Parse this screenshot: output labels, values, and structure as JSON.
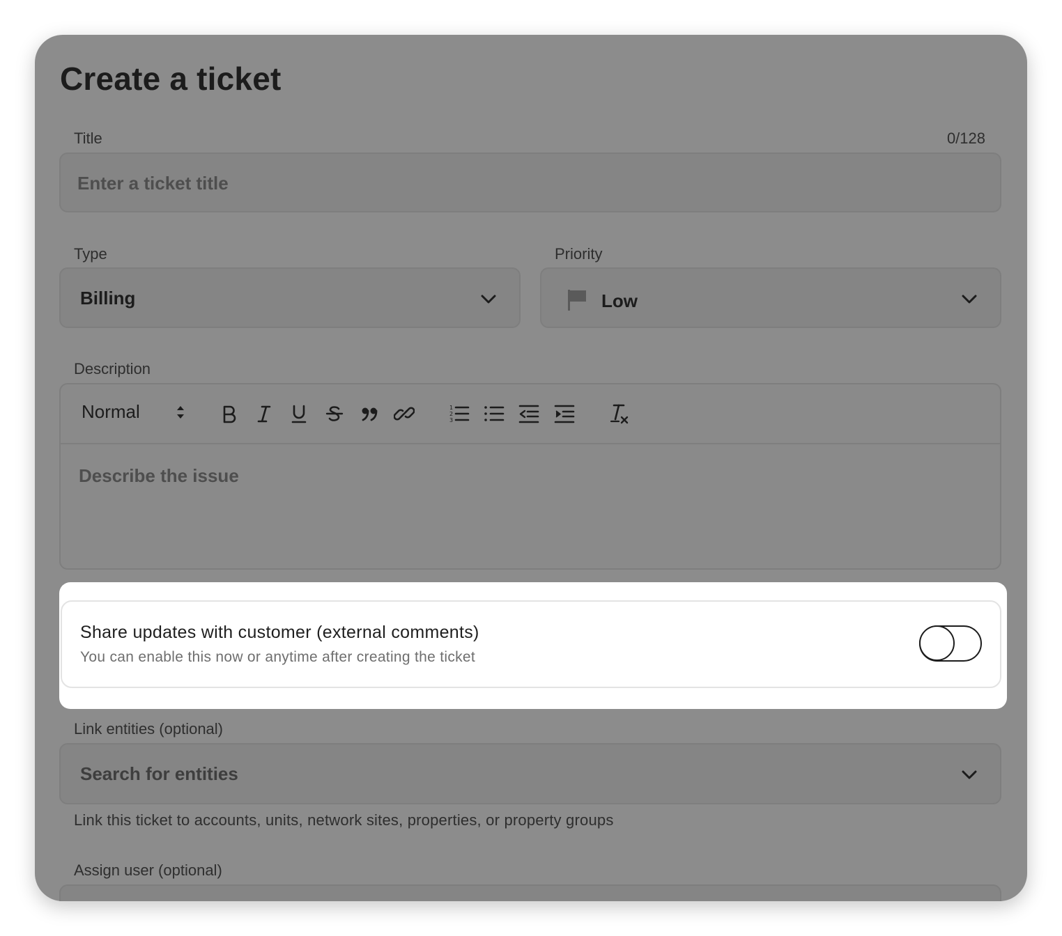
{
  "form": {
    "heading": "Create a ticket",
    "title_field": {
      "label": "Title",
      "counter": "0/128",
      "placeholder": "Enter a ticket title"
    },
    "type_field": {
      "label": "Type",
      "value": "Billing",
      "icon": "chevron-down-icon"
    },
    "priority_field": {
      "label": "Priority",
      "value": "Low",
      "icon": "flag-icon"
    },
    "description": {
      "label": "Description",
      "format_value": "Normal",
      "placeholder": "Describe the issue",
      "tools": [
        "bold",
        "italic",
        "underline",
        "strikethrough",
        "blockquote",
        "link",
        "ordered-list",
        "bullet-list",
        "outdent",
        "indent",
        "clear-formatting"
      ]
    },
    "share": {
      "title": "Share updates with customer (external comments)",
      "subtitle": "You can enable this now or anytime after creating the ticket",
      "enabled": false
    },
    "entities": {
      "label": "Link entities (optional)",
      "placeholder": "Search for entities",
      "helper": "Link this ticket to accounts, units, network sites, properties, or property groups"
    },
    "assign": {
      "label": "Assign user (optional)"
    }
  }
}
